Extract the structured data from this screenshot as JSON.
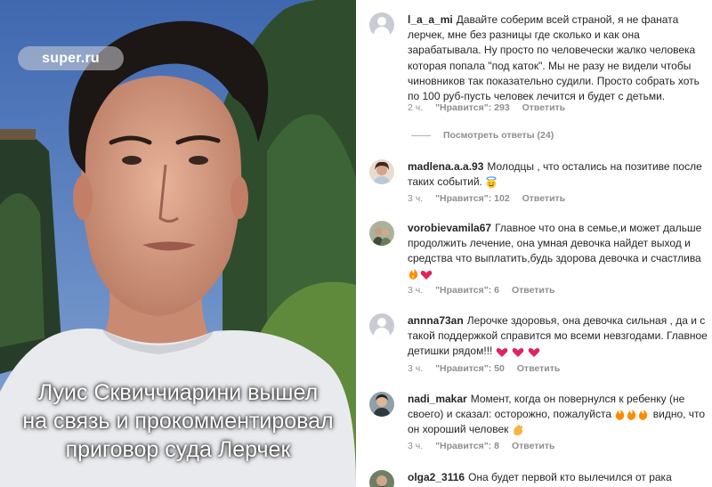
{
  "photo": {
    "watermark": "super.ru",
    "caption_lines": [
      "Луис Сквиччиарини вышел",
      "на связь и прокомментировал",
      "приговор суда Лерчек"
    ]
  },
  "comments": [
    {
      "username": "l_a_a_mi",
      "text": "Давайте соберим всей страной, я не фаната лерчек, мне без разницы где сколько и как она зарабатывала. Ну просто по человечески жалко человека которая попала \"под каток\". Мы не разу не видели чтобы чиновников так показательно судили. Просто собрать хоть по 100 руб-пусть человек лечится и будет с детьми.",
      "time": "2 ч.",
      "likes_label": "\"Нравится\": 293",
      "reply": "Ответить",
      "avatar": "default-avatar"
    },
    {
      "username": "madlena.a.a.93",
      "text": "Молодцы , что остались на позитиве после таких событий.",
      "emoji": "smiling-face-with-halo",
      "time": "3 ч.",
      "likes_label": "\"Нравится\": 102",
      "reply": "Ответить",
      "avatar": "photo-avatar"
    },
    {
      "username": "vorobievamila67",
      "text": "Главное что она в семье,и может дальше продолжить лечение, она умная девочка найдет выход и средства что выплатить,будь здорова девочка и счастлива",
      "emoji": "fire-heart",
      "time": "3 ч.",
      "likes_label": "\"Нравится\": 6",
      "reply": "Ответить",
      "avatar": "photo-avatar"
    },
    {
      "username": "annna73an",
      "text": "Лерочке здоровья, она девочка сильная , да и с такой поддержкой справится мо всеми невзгодами. Главное детишки рядом!!!",
      "emoji": "three-hearts",
      "time": "3 ч.",
      "likes_label": "\"Нравится\": 50",
      "reply": "Ответить",
      "avatar": "default-avatar"
    },
    {
      "username": "nadi_makar",
      "text_before": "Момент, когда он повернулся к ребенку (не своего) и сказал: осторожно, пожалуйста",
      "text_after": "видно, что он хороший человек",
      "emoji": "fire-clap",
      "time": "3 ч.",
      "likes_label": "\"Нравится\": 8",
      "reply": "Ответить",
      "avatar": "photo-avatar"
    },
    {
      "username": "olga2_3116",
      "text": "Она будет первой кто вылечился от рака",
      "avatar": "photo-avatar"
    }
  ],
  "view_replies": "Посмотреть ответы (24)",
  "colors": {
    "text": "#262626",
    "meta": "#8e8e8e",
    "heart": "#ed4956",
    "fire": "#ff7a00"
  }
}
